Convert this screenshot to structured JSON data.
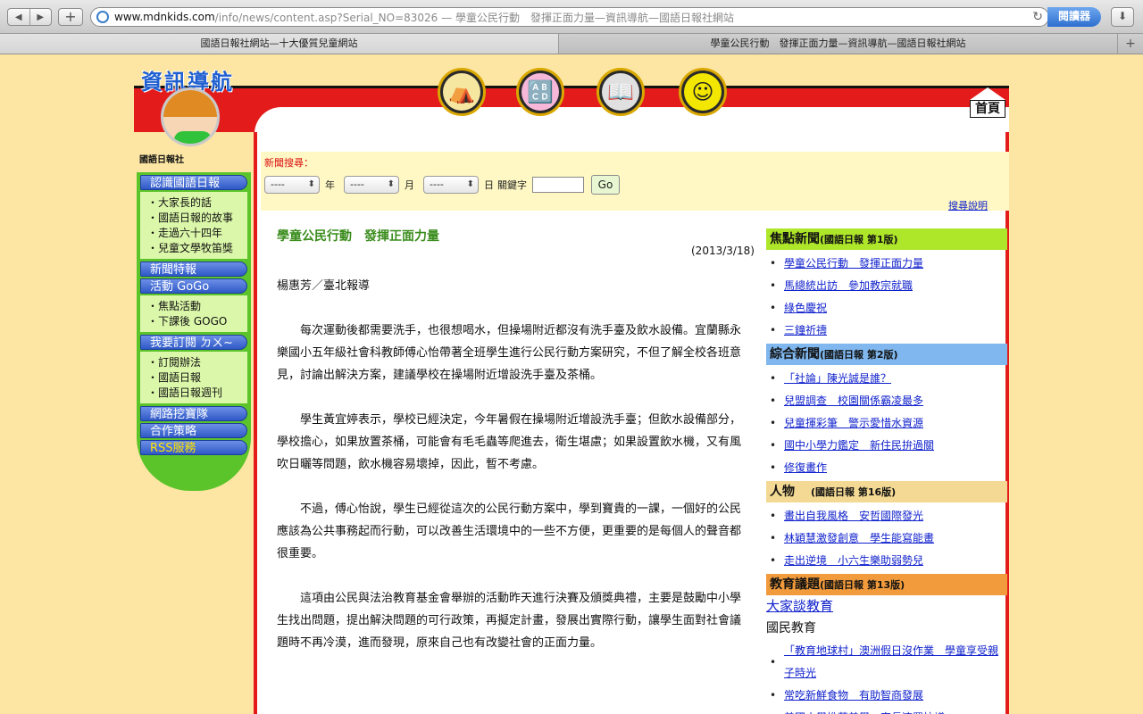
{
  "browser": {
    "url_host": "www.mdnkids.com",
    "url_rest": "/info/news/content.asp?Serial_NO=83026 — 學童公民行動　發揮正面力量—資訊導航—國語日報社網站",
    "reader_label": "閱讀器",
    "tabs": [
      {
        "label": "國語日報社網站—十大優質兒童網站"
      },
      {
        "label": "學童公民行動　發揮正面力量—資訊導航—國語日報社網站"
      }
    ]
  },
  "site": {
    "logo_title": "資訊導航",
    "publisher": "國語日報社",
    "home_label": "首頁",
    "top_icons": [
      "tent-icon",
      "blocks-icon",
      "book-icon",
      "smiley-icon"
    ]
  },
  "left_menu": {
    "sections": [
      {
        "head": "認識國語日報",
        "items": [
          "大家長的話",
          "國語日報的故事",
          "走過六十四年",
          "兒童文學牧笛獎"
        ]
      },
      {
        "head": "新聞特報",
        "items": []
      },
      {
        "head": "活動 GoGo",
        "items": [
          "焦點活動",
          "下課後 GOGO"
        ]
      },
      {
        "head": "我要訂閱 ㄉㄨ~",
        "items": [
          "訂閱辦法",
          "國語日報",
          "國語日報週刊"
        ]
      },
      {
        "head": "網路挖寶隊",
        "items": []
      },
      {
        "head": "合作策略",
        "items": []
      },
      {
        "head": "RSS服務",
        "items": []
      }
    ]
  },
  "search": {
    "title": "新聞搜尋：",
    "year_value": "----",
    "year_label": "年",
    "month_value": "----",
    "month_label": "月",
    "day_value": "----",
    "day_label": "日",
    "keyword_label": "關鍵字",
    "go_label": "Go",
    "help_link": "搜尋說明"
  },
  "article": {
    "title": "學童公民行動　發揮正面力量",
    "date": "(2013/3/18)",
    "byline": "楊惠芳／臺北報導",
    "paragraphs": [
      "每次運動後都需要洗手，也很想喝水，但操場附近都沒有洗手臺及飲水設備。宜蘭縣永樂國小五年級社會科教師傅心怡帶著全班學生進行公民行動方案研究，不但了解全校各班意見，討論出解決方案，建議學校在操場附近增設洗手臺及茶桶。",
      "學生黃宜婷表示，學校已經決定，今年暑假在操場附近增設洗手臺；但飲水設備部分，學校擔心，如果放置茶桶，可能會有毛毛蟲等爬進去，衛生堪慮；如果設置飲水機，又有風吹日曬等問題，飲水機容易壞掉，因此，暫不考慮。",
      "不過，傅心怡說，學生已經從這次的公民行動方案中，學到寶貴的一課，一個好的公民應該為公共事務起而行動，可以改善生活環境中的一些不方便，更重要的是每個人的聲音都很重要。",
      "這項由公民與法治教育基金會舉辦的活動昨天進行決賽及頒獎典禮，主要是鼓勵中小學生找出問題，提出解決問題的可行政策，再擬定計畫，發展出實際行動，讓學生面對社會議題時不再冷漠，進而發現，原來自己也有改變社會的正面力量。"
    ]
  },
  "sidebar": {
    "sections": [
      {
        "title": "焦點新聞",
        "edition": "(國語日報 第1版)",
        "color": "#aee62a",
        "items": [
          "學童公民行動　發揮正面力量",
          "馬總統出訪　參加教宗就職",
          "綠色慶祝",
          "三鐘祈禱"
        ]
      },
      {
        "title": "綜合新聞",
        "edition": "(國語日報 第2版)",
        "color": "#7fb7ee",
        "items": [
          "「社論」陳光誠是誰？",
          "兒盟調查　校園關係霸凌最多",
          "兒童揮彩筆　警示愛惜水資源",
          "國中小學力鑑定　新住民拚過關",
          "修復畫作"
        ]
      },
      {
        "title": "人物",
        "edition": "(國語日報 第16版)",
        "color": "#f3d993",
        "items": [
          "畫出自我風格　安哲國際發光",
          "林穎慧激發創意　學生能寫能畫",
          "走出逆境　小六生樂助弱勢兒"
        ]
      },
      {
        "title": "教育議題",
        "edition": "(國語日報 第13版)",
        "color": "#f29b3c",
        "link": "大家談教育",
        "subhead": "國民教育",
        "items": [
          "「教育地球村」澳洲假日沒作業　學童享受親子時光",
          "常吃新鮮食物　有助智商發展",
          "美國小學推蒔美學　家長連署抗議"
        ]
      }
    ]
  }
}
